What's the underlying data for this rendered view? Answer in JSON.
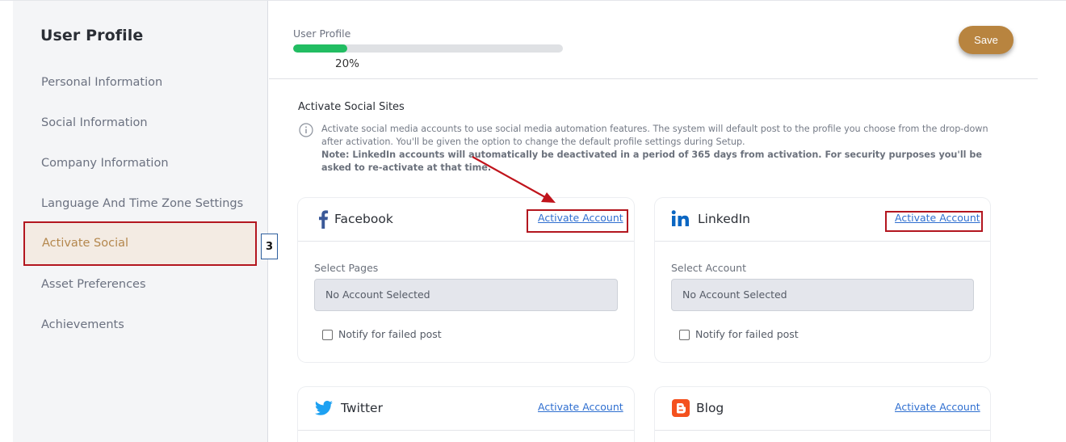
{
  "sidebar": {
    "title": "User Profile",
    "items": [
      {
        "label": "Personal Information"
      },
      {
        "label": "Social Information"
      },
      {
        "label": "Company Information"
      },
      {
        "label": "Language And Time Zone Settings"
      },
      {
        "label": "Activate Social",
        "active": true
      },
      {
        "label": "Asset Preferences"
      },
      {
        "label": "Achievements"
      }
    ],
    "step_badge": "3"
  },
  "header": {
    "progress_label": "User Profile",
    "progress_percent": "20%",
    "progress_value": 0.2,
    "save_label": "Save"
  },
  "section": {
    "title": "Activate Social Sites",
    "info_text": "Activate social media accounts to use social media automation features. The system will default post to the profile you choose from the drop-down after activation. You'll be given the option to change the default profile settings during Setup.",
    "note_text": "Note: LinkedIn accounts will automatically be deactivated in a period of 365 days from activation. For security purposes you'll be asked to re-activate at that time."
  },
  "cards": {
    "facebook": {
      "name": "Facebook",
      "link": "Activate Account",
      "field_label": "Select Pages",
      "select_value": "No Account Selected",
      "notify_label": "Notify for failed post"
    },
    "linkedin": {
      "name": "LinkedIn",
      "link": "Activate Account",
      "field_label": "Select Account",
      "select_value": "No Account Selected",
      "notify_label": "Notify for failed post"
    },
    "twitter": {
      "name": "Twitter",
      "link": "Activate Account"
    },
    "blog": {
      "name": "Blog",
      "link": "Activate Account"
    }
  },
  "colors": {
    "accent": "#b8843f",
    "progress": "#22bd62",
    "highlight": "#b3161f",
    "link": "#2f6fd0",
    "facebook": "#3b5998",
    "linkedin": "#0a66c2",
    "twitter": "#1da1f2",
    "blog": "#f4511e"
  },
  "icons": [
    "facebook-icon",
    "linkedin-icon",
    "twitter-icon",
    "blog-icon",
    "info-icon"
  ]
}
